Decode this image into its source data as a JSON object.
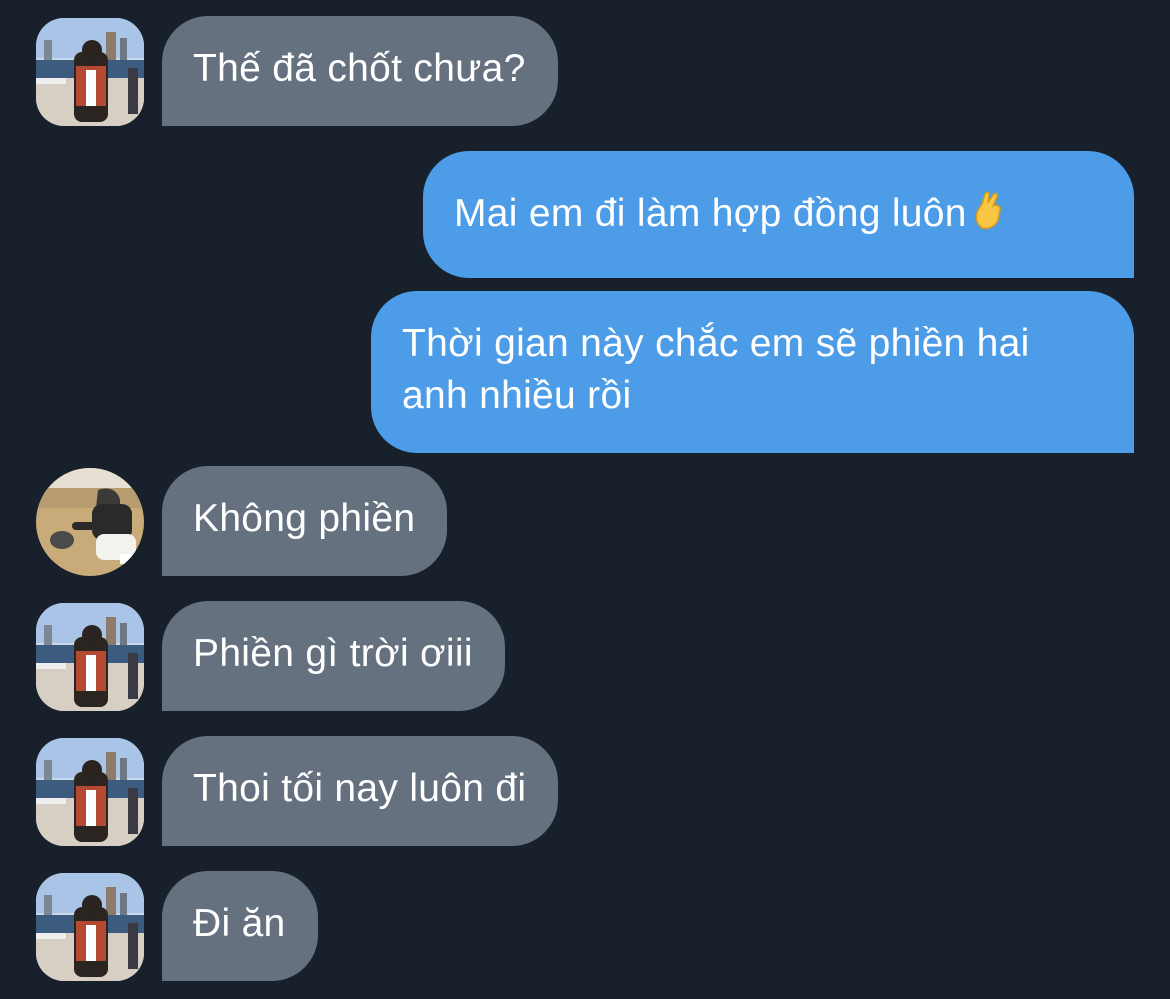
{
  "conversation": {
    "messages": [
      {
        "direction": "incoming",
        "avatar": "user-photo-city",
        "text": "Thế đã chốt chưa?"
      },
      {
        "direction": "outgoing",
        "text": "Mai em đi làm hợp đồng luôn",
        "emoji": "crossed-fingers-icon"
      },
      {
        "direction": "outgoing",
        "lines": [
          "Thời gian này chắc em sẽ phiền hai",
          "anh nhiều rồi"
        ]
      },
      {
        "direction": "incoming",
        "avatar": "user-photo-field",
        "text": "Không phiền"
      },
      {
        "direction": "incoming",
        "avatar": "user-photo-city",
        "text": "Phiền gì trời ơiii"
      },
      {
        "direction": "incoming",
        "avatar": "user-photo-city",
        "text": "Thoi tối nay luôn đi"
      },
      {
        "direction": "incoming",
        "avatar": "user-photo-city",
        "text": "Đi ăn"
      }
    ]
  },
  "colors": {
    "background": "#17202b",
    "incoming_bubble": "#65717f",
    "outgoing_bubble": "#4d9ce8",
    "text": "#ffffff"
  }
}
